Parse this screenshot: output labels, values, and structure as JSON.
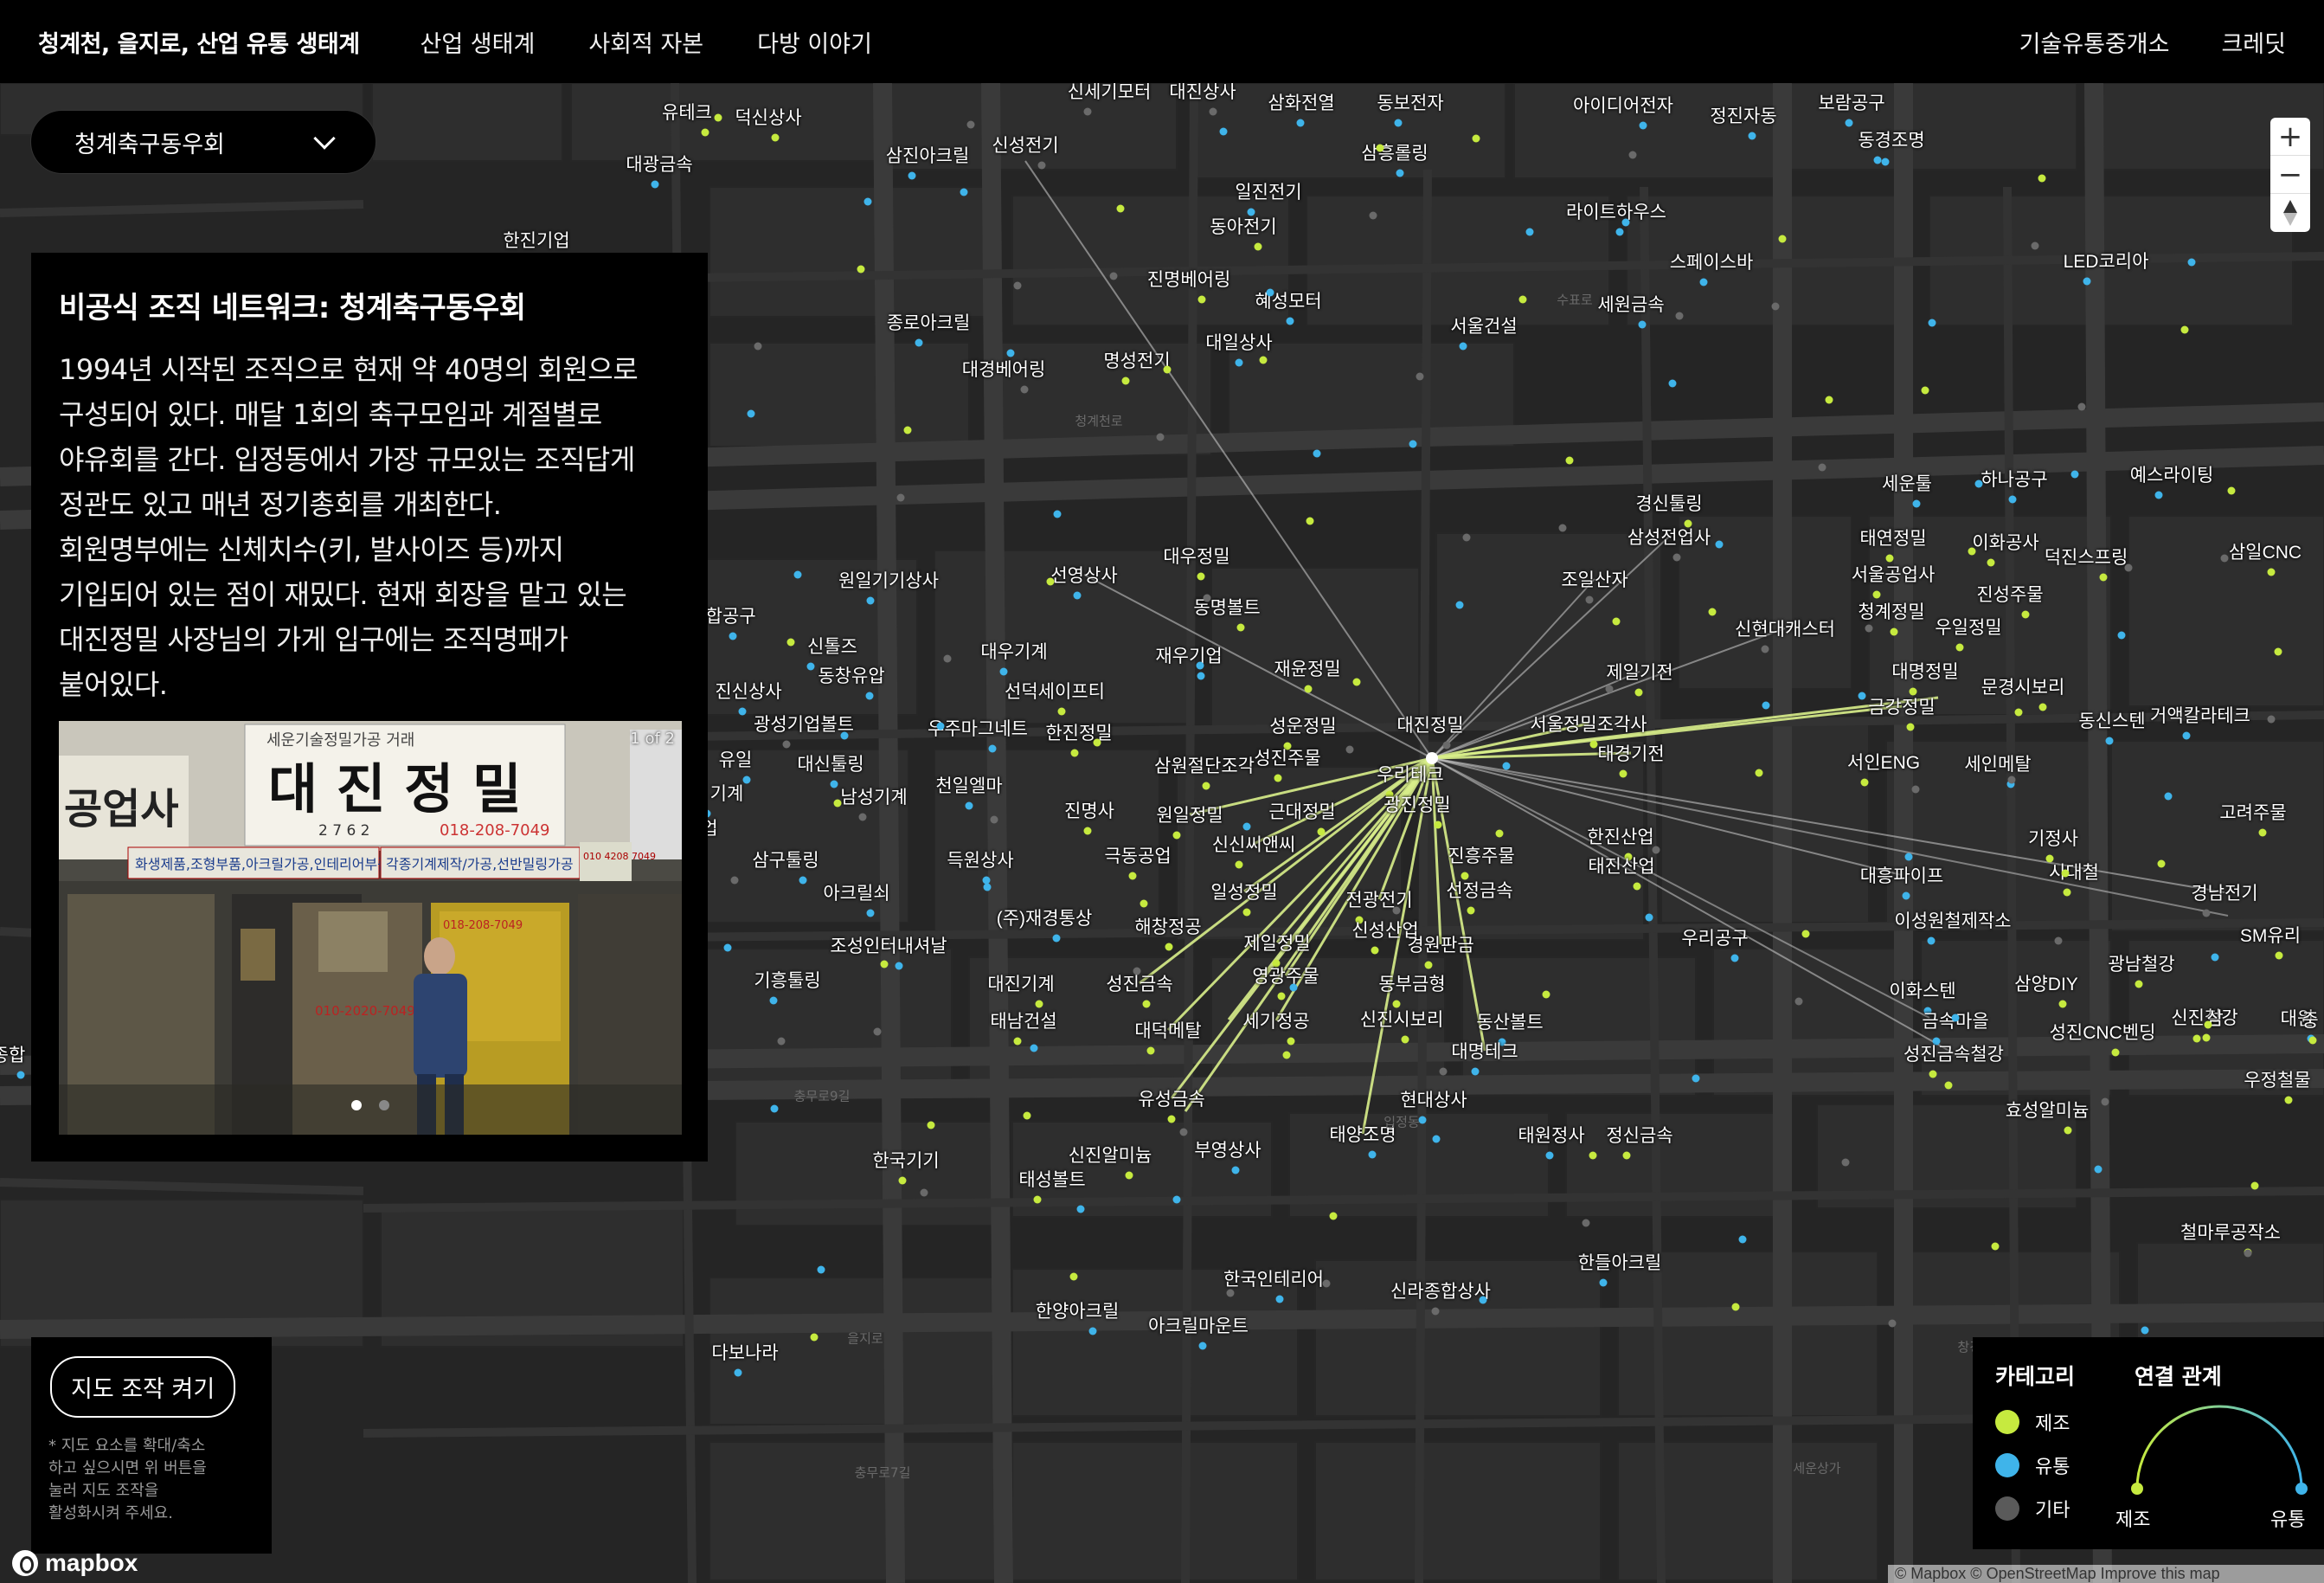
{
  "header": {
    "brand": "청계천, 을지로, 산업 유통 생태계",
    "nav": [
      "산업 생태계",
      "사회적 자본",
      "다방 이야기"
    ],
    "nav_right": [
      "기술유통중개소",
      "크레딧"
    ]
  },
  "dropdown": {
    "selected": "청계축구동우회"
  },
  "panel": {
    "title": "비공식 조직 네트워크: 청계축구동우회",
    "body_lines": [
      "1994년 시작된 조직으로 현재 약 40명의 회원으로",
      "구성되어 있다. 매달 1회의 축구모임과 계절별로",
      "야유회를 간다. 입정동에서 가장 규모있는 조직답게",
      "정관도 있고 매년 정기총회를 개최한다.",
      "회원명부에는 신체치수(키, 발사이즈 등)까지",
      "기입되어 있는 점이 재밌다. 현재 회장을 맡고 있는",
      "대진정밀 사장님의 가게 입구에는 조직명패가",
      "붙어있다."
    ],
    "photo": {
      "counter": "1 of 2",
      "sign_main": "대 진 정 밀",
      "sign_top": "세운기술정밀가공 거래",
      "sign_phone": "018-208-7049",
      "sign_left": "공업사",
      "sign_strip1": "화생제품,조형부품,아크릴가공,인테리어부품",
      "sign_strip2": "각종기계제작/가공,선반밀링가공",
      "sign_small": "2 7 6 2",
      "sign_num": "010 4208 7049",
      "sign_door": "010-2020-7049",
      "sign_door2": "018-208-7049"
    }
  },
  "map_controls": {
    "zoom_in": "+",
    "zoom_out": "−",
    "compass": "compass-icon"
  },
  "toggle": {
    "button": "지도 조작 켜기",
    "note_lines": [
      "* 지도 요소를 확대/축소",
      "하고 싶으시면 위 버튼을",
      "눌러 지도 조작을",
      "활성화시켜 주세요."
    ]
  },
  "mapbox": {
    "logo": "mapbox",
    "attribution": "© Mapbox © OpenStreetMap Improve this map"
  },
  "legend": {
    "category_title": "카테고리",
    "relation_title": "연결 관계",
    "items": [
      {
        "label": "제조",
        "color": "#c6ea3f"
      },
      {
        "label": "유통",
        "color": "#3fb4ea"
      },
      {
        "label": "기타",
        "color": "#5a5a5a"
      }
    ],
    "arc_from": "제조",
    "arc_to": "유통"
  },
  "colors": {
    "manufacturing": "#c6ea3f",
    "distribution": "#3fb4ea",
    "other": "#6a6a6a",
    "line_mfg": "#d9ef8a",
    "line_other": "#cfcfcf"
  },
  "hub": {
    "name": "대진정밀"
  },
  "places": [
    {
      "n": "신세기모터",
      "c": "o"
    },
    {
      "n": "대진상사",
      "c": "o"
    },
    {
      "n": "삼화전열",
      "c": "d"
    },
    {
      "n": "동보전자",
      "c": "d"
    },
    {
      "n": "아이디어전자",
      "c": "d"
    },
    {
      "n": "정진자동",
      "c": "d"
    },
    {
      "n": "보람공구",
      "c": "d"
    },
    {
      "n": "동경조명",
      "c": "d"
    },
    {
      "n": "유테크",
      "c": "m"
    },
    {
      "n": "덕신상사",
      "c": "m"
    },
    {
      "n": "대광금속",
      "c": "d"
    },
    {
      "n": "삼진아크릴",
      "c": "d"
    },
    {
      "n": "신성전기",
      "c": "o"
    },
    {
      "n": "삼흥롤링",
      "c": "d"
    },
    {
      "n": "한진기업",
      "c": "m"
    },
    {
      "n": "일진전기",
      "c": "d"
    },
    {
      "n": "동아전기",
      "c": "m"
    },
    {
      "n": "라이트하우스",
      "c": "d"
    },
    {
      "n": "스페이스바",
      "c": "d"
    },
    {
      "n": "LED코리아",
      "c": "d"
    },
    {
      "n": "진명베어링",
      "c": "m"
    },
    {
      "n": "혜성모터",
      "c": "d"
    },
    {
      "n": "종로아크릴",
      "c": "d"
    },
    {
      "n": "서울건설",
      "c": "d"
    },
    {
      "n": "세원금속",
      "c": "d"
    },
    {
      "n": "대일상사",
      "c": "d"
    },
    {
      "n": "명성전기",
      "c": "m"
    },
    {
      "n": "대경베어링",
      "c": "o"
    },
    {
      "n": "세운툴",
      "c": "d"
    },
    {
      "n": "하나공구",
      "c": "d"
    },
    {
      "n": "예스라이팅",
      "c": "d"
    },
    {
      "n": "경신툴링",
      "c": "m"
    },
    {
      "n": "삼성전업사",
      "c": "o"
    },
    {
      "n": "태연정밀",
      "c": "m"
    },
    {
      "n": "이화공사",
      "c": "m"
    },
    {
      "n": "덕진스프링",
      "c": "m"
    },
    {
      "n": "삼일CNC",
      "c": "m"
    },
    {
      "n": "조일산자",
      "c": "o"
    },
    {
      "n": "서울공업사",
      "c": "m"
    },
    {
      "n": "진성주물",
      "c": "m"
    },
    {
      "n": "대우정밀",
      "c": "m"
    },
    {
      "n": "선영상사",
      "c": "d"
    },
    {
      "n": "원일기기상사",
      "c": "d"
    },
    {
      "n": "동명볼트",
      "c": "m"
    },
    {
      "n": "청계정밀",
      "c": "m"
    },
    {
      "n": "우일정밀",
      "c": "m"
    },
    {
      "n": "신현대캐스터",
      "c": "o"
    },
    {
      "n": "재우기업",
      "c": "d"
    },
    {
      "n": "재윤정밀",
      "c": "m"
    },
    {
      "n": "대우기계",
      "c": "d"
    },
    {
      "n": "신톨즈",
      "c": "d"
    },
    {
      "n": "종합공구",
      "c": "d"
    },
    {
      "n": "제일기전",
      "c": "m"
    },
    {
      "n": "대명정밀",
      "c": "m"
    },
    {
      "n": "문경시보리",
      "c": "m"
    },
    {
      "n": "금강정밀",
      "c": "m"
    },
    {
      "n": "동신스텐",
      "c": "d"
    },
    {
      "n": "거액칼라테크",
      "c": "d"
    },
    {
      "n": "동창유압",
      "c": "d"
    },
    {
      "n": "선덕세이프티",
      "c": "m"
    },
    {
      "n": "한진정밀",
      "c": "m"
    },
    {
      "n": "성운정밀",
      "c": "m"
    },
    {
      "n": "대진정밀",
      "c": "o"
    },
    {
      "n": "서울정밀조각사",
      "c": "m"
    },
    {
      "n": "진신상사",
      "c": "d"
    },
    {
      "n": "광성기업볼트",
      "c": "o"
    },
    {
      "n": "우주마그네트",
      "c": "d"
    },
    {
      "n": "대신툴링",
      "c": "d"
    },
    {
      "n": "태경기전",
      "c": "m"
    },
    {
      "n": "서인ENG",
      "c": "m"
    },
    {
      "n": "세인메탈",
      "c": "d"
    },
    {
      "n": "삼원절단조각",
      "c": "m"
    },
    {
      "n": "성진주물",
      "c": "m"
    },
    {
      "n": "우리테크",
      "c": "m"
    },
    {
      "n": "유일",
      "c": "d"
    },
    {
      "n": "천일엘마",
      "c": "d"
    },
    {
      "n": "남성기계",
      "c": "o"
    },
    {
      "n": "광진정밀",
      "c": "m"
    },
    {
      "n": "고려주물",
      "c": "m"
    },
    {
      "n": "진명사",
      "c": "m"
    },
    {
      "n": "원일정밀",
      "c": "m"
    },
    {
      "n": "근대정밀",
      "c": "m"
    },
    {
      "n": "한진산업",
      "c": "m"
    },
    {
      "n": "기정사",
      "c": "m"
    },
    {
      "n": "신신씨앤씨",
      "c": "m"
    },
    {
      "n": "삼구툴링",
      "c": "d"
    },
    {
      "n": "득원상사",
      "c": "d"
    },
    {
      "n": "극동공업",
      "c": "m"
    },
    {
      "n": "진흥주물",
      "c": "m"
    },
    {
      "n": "태진산업",
      "c": "m"
    },
    {
      "n": "대흥파이프",
      "c": "d"
    },
    {
      "n": "시대철",
      "c": "m"
    },
    {
      "n": "경남전기",
      "c": "o"
    },
    {
      "n": "아크릴쇠",
      "c": "d"
    },
    {
      "n": "일성정밀",
      "c": "m"
    },
    {
      "n": "선정금속",
      "c": "m"
    },
    {
      "n": "전광전기",
      "c": "m"
    },
    {
      "n": "(주)재경통상",
      "c": "d"
    },
    {
      "n": "해창정공",
      "c": "m"
    },
    {
      "n": "신성산업",
      "c": "m"
    },
    {
      "n": "이성원철제작소",
      "c": "d"
    },
    {
      "n": "조성인터내셔날",
      "c": "d"
    },
    {
      "n": "제일정밀",
      "c": "m"
    },
    {
      "n": "경원판금",
      "c": "m"
    },
    {
      "n": "우리공구",
      "c": "d"
    },
    {
      "n": "SM유리",
      "c": "m"
    },
    {
      "n": "광남철강",
      "c": "m"
    },
    {
      "n": "기흥툴링",
      "c": "d"
    },
    {
      "n": "대진기계",
      "c": "m"
    },
    {
      "n": "성진금속",
      "c": "m"
    },
    {
      "n": "영광주물",
      "c": "m"
    },
    {
      "n": "동부금형",
      "c": "m"
    },
    {
      "n": "삼양DIY",
      "c": "m"
    },
    {
      "n": "이화스텐",
      "c": "d"
    },
    {
      "n": "태남건설",
      "c": "m"
    },
    {
      "n": "대덕메탈",
      "c": "m"
    },
    {
      "n": "세기정공",
      "c": "m"
    },
    {
      "n": "신진시보리",
      "c": "m"
    },
    {
      "n": "동산볼트",
      "c": "d"
    },
    {
      "n": "금속마을",
      "c": "d"
    },
    {
      "n": "성진CNC벤딩",
      "c": "m"
    },
    {
      "n": "신진철강",
      "c": "m"
    },
    {
      "n": "대명테크",
      "c": "d"
    },
    {
      "n": "성진금속철강",
      "c": "m"
    },
    {
      "n": "우정철물",
      "c": "m"
    },
    {
      "n": "유성금속",
      "c": "m"
    },
    {
      "n": "현대상사",
      "c": "d"
    },
    {
      "n": "효성알미늄",
      "c": "m"
    },
    {
      "n": "태양조명",
      "c": "d"
    },
    {
      "n": "태원정사",
      "c": "d"
    },
    {
      "n": "정신금속",
      "c": "m"
    },
    {
      "n": "신진알미늄",
      "c": "m"
    },
    {
      "n": "부영상사",
      "c": "d"
    },
    {
      "n": "한국기기",
      "c": "m"
    },
    {
      "n": "태성볼트",
      "c": "m"
    },
    {
      "n": "철마루공작소",
      "c": "m"
    },
    {
      "n": "한국인테리어",
      "c": "d"
    },
    {
      "n": "신라종합상사",
      "c": "o"
    },
    {
      "n": "한들아크릴",
      "c": "d"
    },
    {
      "n": "한양아크릴",
      "c": "d"
    },
    {
      "n": "아크릴마운트",
      "c": "d"
    },
    {
      "n": "다보나라",
      "c": "d"
    },
    {
      "n": "삼",
      "c": "m"
    },
    {
      "n": "대원",
      "c": "d"
    },
    {
      "n": "중",
      "c": "m"
    },
    {
      "n": "업",
      "c": "d"
    },
    {
      "n": "기계",
      "c": "d"
    },
    {
      "n": "종합",
      "c": "d"
    }
  ],
  "road_labels": [
    "청계천로",
    "을지로",
    "충무로9길",
    "충무로7길",
    "수표로",
    "창경궁로",
    "세운상가",
    "입정동"
  ]
}
